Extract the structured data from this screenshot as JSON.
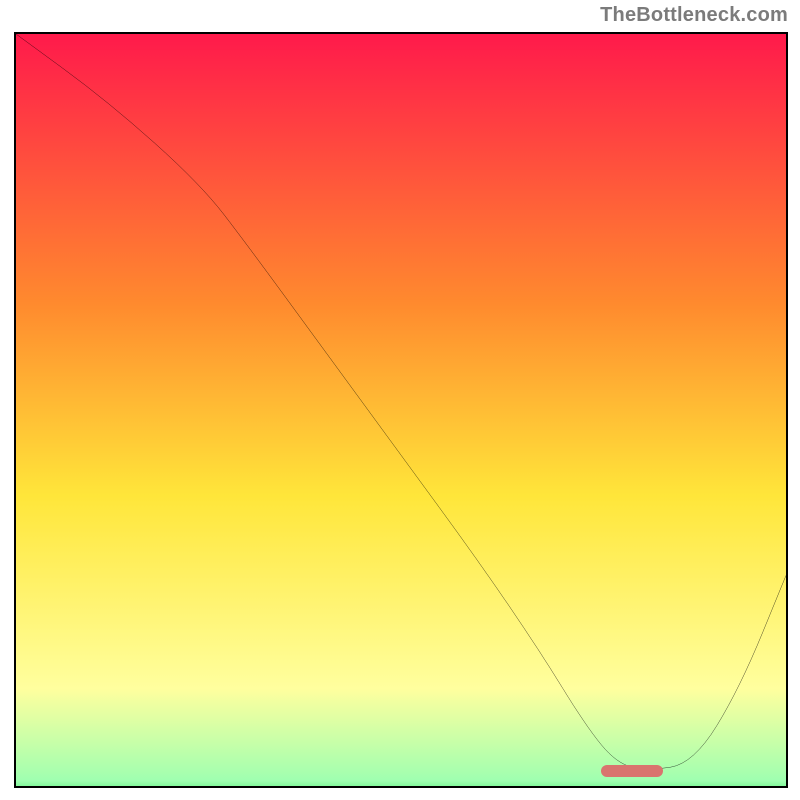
{
  "watermark": "TheBottleneck.com",
  "colors": {
    "top": "#ff1a4b",
    "mid_upper": "#ff9a2e",
    "mid": "#ffe63a",
    "pale": "#ffff9e",
    "bottom": "#28e65a",
    "marker": "#d9746e",
    "curve": "#000000"
  },
  "chart_data": {
    "type": "line",
    "title": "",
    "xlabel": "",
    "ylabel": "",
    "xlim": [
      0,
      100
    ],
    "ylim": [
      0,
      100
    ],
    "x": [
      0,
      12,
      24,
      30,
      40,
      50,
      60,
      68,
      74,
      78,
      82,
      88,
      94,
      100
    ],
    "values": [
      100,
      91,
      80,
      72,
      58,
      44,
      30,
      18,
      8,
      3,
      2,
      3,
      13,
      28
    ],
    "marker_range_x": [
      76,
      84
    ],
    "marker_y": 2,
    "gradient_stops": [
      {
        "pct": 0,
        "color": "#ff1a4b"
      },
      {
        "pct": 35,
        "color": "#ff8a2e"
      },
      {
        "pct": 60,
        "color": "#ffe63a"
      },
      {
        "pct": 85,
        "color": "#ffff9e"
      },
      {
        "pct": 97,
        "color": "#9fffb0"
      },
      {
        "pct": 100,
        "color": "#28e65a"
      }
    ]
  }
}
